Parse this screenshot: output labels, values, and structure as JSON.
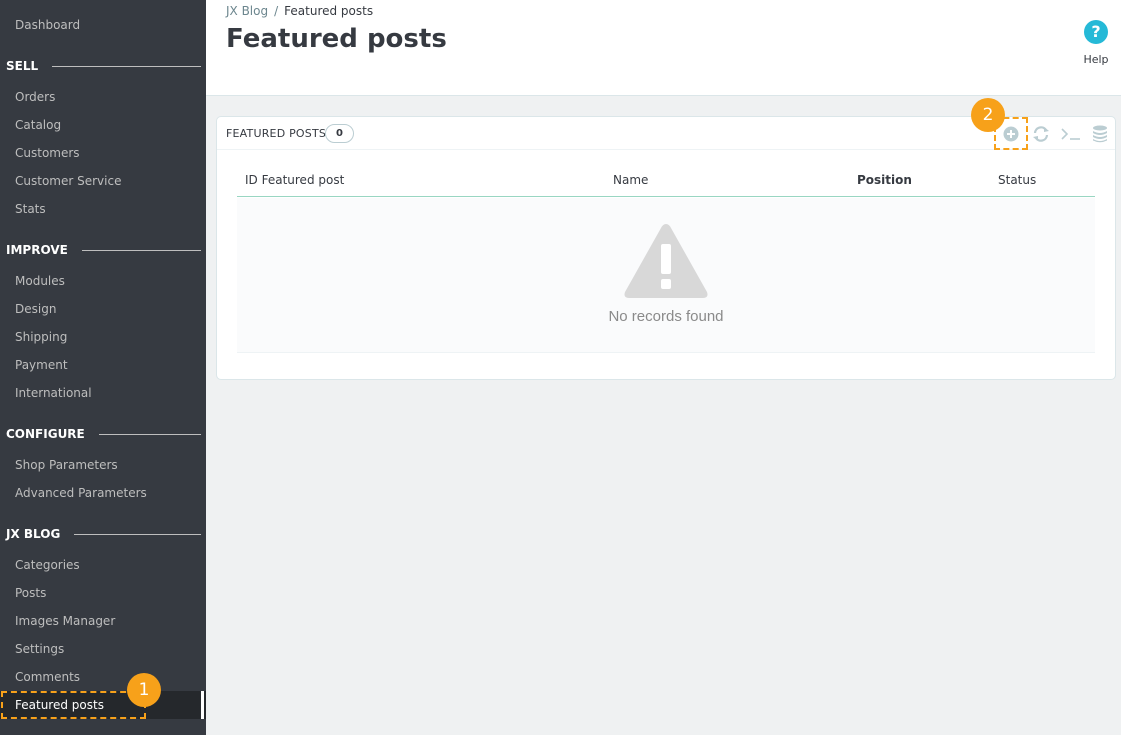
{
  "sidebar": {
    "dashboard": "Dashboard",
    "sections": {
      "sell": "SELL",
      "improve": "IMPROVE",
      "configure": "CONFIGURE",
      "jxblog": "JX BLOG"
    },
    "items": {
      "orders": "Orders",
      "catalog": "Catalog",
      "customers": "Customers",
      "customer_service": "Customer Service",
      "stats": "Stats",
      "modules": "Modules",
      "design": "Design",
      "shipping": "Shipping",
      "payment": "Payment",
      "international": "International",
      "shop_parameters": "Shop Parameters",
      "advanced_parameters": "Advanced Parameters",
      "categories": "Categories",
      "posts": "Posts",
      "images_manager": "Images Manager",
      "settings": "Settings",
      "comments": "Comments",
      "featured_posts": "Featured posts"
    }
  },
  "header": {
    "breadcrumb_parent": "JX Blog",
    "breadcrumb_separator": "/",
    "breadcrumb_current": "Featured posts",
    "title": "Featured posts",
    "help_icon": "?",
    "help_label": "Help"
  },
  "panel": {
    "title": "FEATURED POSTS",
    "count": "0",
    "columns": {
      "id": "ID Featured post",
      "name": "Name",
      "position": "Position",
      "status": "Status"
    },
    "empty_message": "No records found",
    "toolbar_icons": [
      "add-new-icon",
      "refresh-icon",
      "sql-query-icon",
      "export-database-icon"
    ]
  },
  "callouts": {
    "one": "1",
    "two": "2"
  },
  "colors": {
    "sidebar_bg": "#363a41",
    "accent": "#25b9d7",
    "callout": "#f7a11a",
    "table_line": "#99d6c2"
  }
}
